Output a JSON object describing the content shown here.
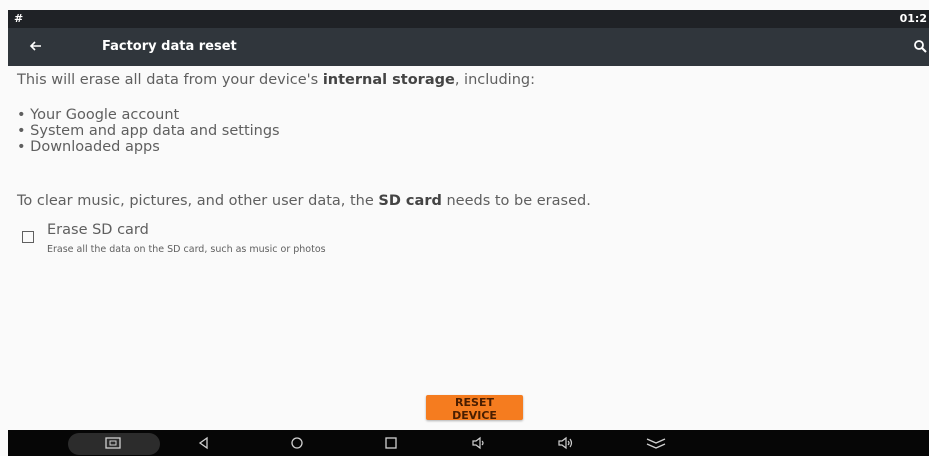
{
  "status_bar": {
    "left_text": "#",
    "time": "01:2"
  },
  "top_bar": {
    "title": "Factory data reset",
    "back_icon": "back-arrow-icon",
    "search_icon": "search-icon"
  },
  "content": {
    "intro_pre": "This will erase all data from your device's ",
    "intro_bold": "internal storage",
    "intro_post": ", including:",
    "bullets": [
      "• Your Google account",
      "• System and app data and settings",
      "• Downloaded apps"
    ],
    "sd_note_pre": "To clear music, pictures, and other user data, the ",
    "sd_note_bold": "SD card",
    "sd_note_post": " needs to be erased.",
    "erase_sd": {
      "title": "Erase SD card",
      "description": "Erase all the data on the SD card, such as music or photos",
      "checked": false
    }
  },
  "reset_button": {
    "label": "RESET DEVICE",
    "color": "#f57c1f"
  },
  "nav_bar": {
    "icons": [
      "screenshot-icon",
      "back-triangle-icon",
      "home-circle-icon",
      "recents-square-icon",
      "volume-down-icon",
      "volume-up-icon",
      "hide-bar-chevron-icon"
    ]
  },
  "colors": {
    "status_bar": "#1f2226",
    "top_bar": "#30363c",
    "background": "#fafafa",
    "nav_bar": "#060606"
  }
}
